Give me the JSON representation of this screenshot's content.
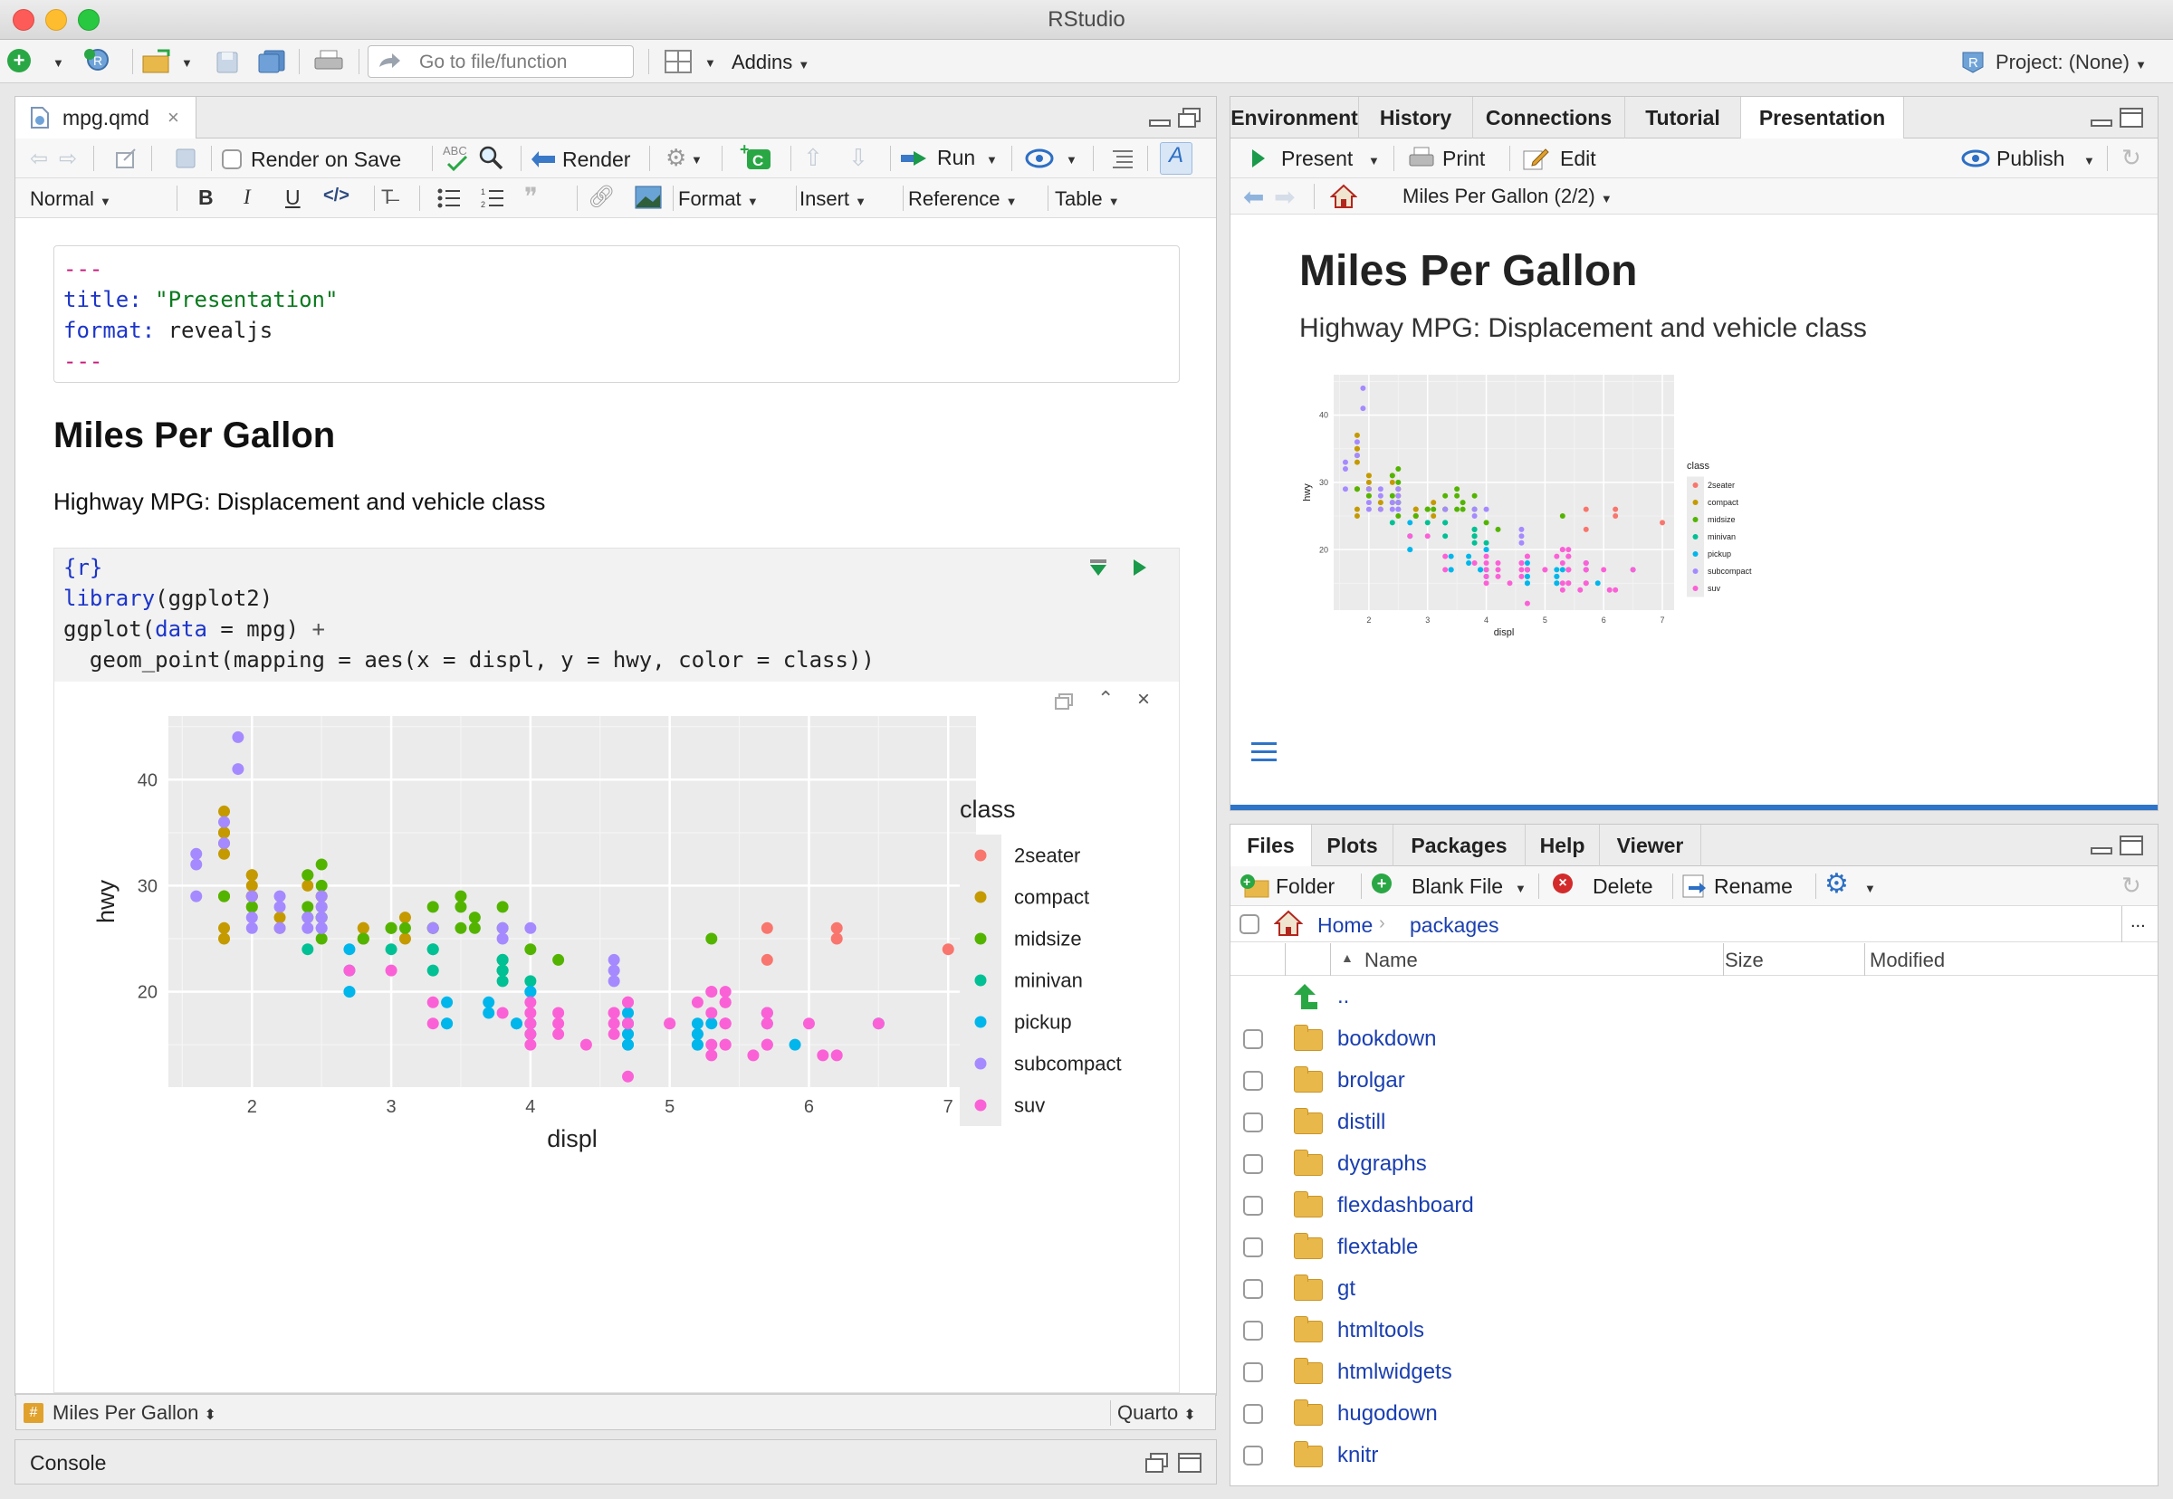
{
  "window": {
    "title": "RStudio"
  },
  "toolbar": {
    "goto_placeholder": "Go to file/function",
    "addins": "Addins",
    "project": "Project: (None)"
  },
  "editor": {
    "tab_name": "mpg.qmd",
    "render_on_save": "Render on Save",
    "render": "Render",
    "run": "Run",
    "format_style": "Normal",
    "menus": {
      "format": "Format",
      "insert": "Insert",
      "reference": "Reference",
      "table": "Table"
    },
    "yaml": {
      "dashes": "---",
      "title_key": "title:",
      "title_val": "\"Presentation\"",
      "format_key": "format:",
      "format_val": "revealjs"
    },
    "heading": "Miles Per Gallon",
    "paragraph": "Highway MPG: Displacement and vehicle class",
    "code": {
      "line1": "{r}",
      "lib_fn": "library",
      "lib_arg": "(ggplot2)",
      "line3a": "ggplot(",
      "line3b": "data",
      "line3c": " = mpg) ",
      "line3d": "+",
      "line4": "  geom_point(mapping = aes(x = displ, y = hwy, color = class))"
    },
    "status_section": "Miles Per Gallon",
    "status_mode": "Quarto"
  },
  "console": {
    "label": "Console"
  },
  "top_right": {
    "tabs": [
      "Environment",
      "History",
      "Connections",
      "Tutorial",
      "Presentation"
    ],
    "present": "Present",
    "print": "Print",
    "edit": "Edit",
    "publish": "Publish",
    "slide_nav": "Miles Per Gallon (2/2)",
    "slide_title": "Miles Per Gallon",
    "slide_subtitle": "Highway MPG: Displacement and vehicle class"
  },
  "bottom_right": {
    "tabs": [
      "Files",
      "Plots",
      "Packages",
      "Help",
      "Viewer"
    ],
    "folder": "Folder",
    "blank_file": "Blank File",
    "delete": "Delete",
    "rename": "Rename",
    "crumb_home": "Home",
    "crumb_sub": "packages",
    "more": "...",
    "col_name": "Name",
    "col_size": "Size",
    "col_modified": "Modified",
    "up": "..",
    "files": [
      "bookdown",
      "brolgar",
      "distill",
      "dygraphs",
      "flexdashboard",
      "flextable",
      "gt",
      "htmltools",
      "htmlwidgets",
      "hugodown",
      "knitr"
    ]
  },
  "chart_data": {
    "type": "scatter",
    "xlabel": "displ",
    "ylabel": "hwy",
    "xlim": [
      1.4,
      7.2
    ],
    "ylim": [
      11,
      46
    ],
    "x_ticks": [
      2,
      3,
      4,
      5,
      6,
      7
    ],
    "y_ticks": [
      20,
      30,
      40
    ],
    "grid": true,
    "legend_title": "class",
    "legend_position": "right",
    "series": [
      {
        "name": "2seater",
        "color": "#F8766D",
        "points": [
          [
            5.7,
            26
          ],
          [
            5.7,
            23
          ],
          [
            6.2,
            26
          ],
          [
            6.2,
            25
          ],
          [
            7.0,
            24
          ]
        ]
      },
      {
        "name": "compact",
        "color": "#C49A00",
        "points": [
          [
            1.8,
            29
          ],
          [
            1.8,
            29
          ],
          [
            2.0,
            31
          ],
          [
            2.0,
            30
          ],
          [
            2.8,
            26
          ],
          [
            2.8,
            26
          ],
          [
            3.1,
            27
          ],
          [
            1.8,
            26
          ],
          [
            1.8,
            25
          ],
          [
            2.0,
            28
          ],
          [
            2.0,
            29
          ],
          [
            2.8,
            25
          ],
          [
            2.8,
            25
          ],
          [
            3.1,
            25
          ],
          [
            2.2,
            27
          ],
          [
            2.2,
            26
          ],
          [
            2.4,
            31
          ],
          [
            2.4,
            30
          ],
          [
            3.0,
            26
          ],
          [
            3.3,
            26
          ],
          [
            1.8,
            34
          ],
          [
            1.8,
            37
          ],
          [
            1.8,
            35
          ],
          [
            2.5,
            29
          ],
          [
            2.5,
            29
          ],
          [
            2.5,
            28
          ],
          [
            2.0,
            29
          ],
          [
            2.0,
            29
          ],
          [
            2.8,
            25
          ],
          [
            1.8,
            33
          ],
          [
            1.8,
            35
          ],
          [
            2.0,
            29
          ],
          [
            2.0,
            31
          ]
        ]
      },
      {
        "name": "midsize",
        "color": "#53B400",
        "points": [
          [
            2.4,
            27
          ],
          [
            2.5,
            30
          ],
          [
            2.5,
            32
          ],
          [
            3.3,
            26
          ],
          [
            3.5,
            29
          ],
          [
            3.5,
            26
          ],
          [
            3.8,
            28
          ],
          [
            3.8,
            26
          ],
          [
            2.5,
            27
          ],
          [
            2.5,
            25
          ],
          [
            3.0,
            26
          ],
          [
            3.1,
            26
          ],
          [
            3.5,
            28
          ],
          [
            3.8,
            23
          ],
          [
            2.4,
            28
          ],
          [
            3.0,
            26
          ],
          [
            3.3,
            26
          ],
          [
            3.8,
            22
          ],
          [
            4.0,
            24
          ],
          [
            4.2,
            23
          ],
          [
            5.3,
            25
          ],
          [
            1.8,
            29
          ],
          [
            2.0,
            28
          ],
          [
            2.8,
            25
          ],
          [
            3.6,
            27
          ],
          [
            3.6,
            26
          ],
          [
            2.4,
            31
          ],
          [
            2.5,
            27
          ],
          [
            2.5,
            27
          ],
          [
            3.3,
            28
          ]
        ]
      },
      {
        "name": "minivan",
        "color": "#00C094",
        "points": [
          [
            2.4,
            24
          ],
          [
            3.0,
            24
          ],
          [
            3.3,
            22
          ],
          [
            3.3,
            24
          ],
          [
            3.8,
            23
          ],
          [
            3.8,
            22
          ],
          [
            4.0,
            21
          ],
          [
            3.8,
            21
          ],
          [
            3.8,
            23
          ],
          [
            3.8,
            22
          ],
          [
            3.3,
            24
          ]
        ]
      },
      {
        "name": "pickup",
        "color": "#00B6EB",
        "points": [
          [
            2.7,
            20
          ],
          [
            2.7,
            22
          ],
          [
            3.4,
            19
          ],
          [
            3.4,
            17
          ],
          [
            4.0,
            20
          ],
          [
            4.0,
            17
          ],
          [
            4.7,
            17
          ],
          [
            4.7,
            16
          ],
          [
            4.7,
            15
          ],
          [
            5.2,
            17
          ],
          [
            5.2,
            16
          ],
          [
            5.7,
            17
          ],
          [
            5.9,
            15
          ],
          [
            4.7,
            16
          ],
          [
            4.7,
            15
          ],
          [
            4.7,
            17
          ],
          [
            5.2,
            16
          ],
          [
            5.2,
            15
          ],
          [
            3.7,
            19
          ],
          [
            3.7,
            18
          ],
          [
            3.9,
            17
          ],
          [
            3.9,
            17
          ],
          [
            4.7,
            17
          ],
          [
            5.2,
            15
          ],
          [
            5.3,
            17
          ],
          [
            4.0,
            16
          ],
          [
            4.7,
            18
          ],
          [
            5.7,
            18
          ],
          [
            6.5,
            17
          ],
          [
            2.7,
            24
          ],
          [
            2.7,
            20
          ],
          [
            3.4,
            17
          ],
          [
            4.0,
            20
          ]
        ]
      },
      {
        "name": "subcompact",
        "color": "#A58AFF",
        "points": [
          [
            1.6,
            33
          ],
          [
            1.6,
            32
          ],
          [
            1.6,
            29
          ],
          [
            1.8,
            36
          ],
          [
            1.8,
            34
          ],
          [
            1.9,
            44
          ],
          [
            1.9,
            41
          ],
          [
            2.0,
            26
          ],
          [
            2.0,
            29
          ],
          [
            2.0,
            27
          ],
          [
            2.2,
            26
          ],
          [
            2.4,
            27
          ],
          [
            2.4,
            26
          ],
          [
            2.5,
            26
          ],
          [
            2.5,
            27
          ],
          [
            2.5,
            26
          ],
          [
            3.8,
            26
          ],
          [
            3.8,
            25
          ],
          [
            4.0,
            26
          ],
          [
            4.6,
            23
          ],
          [
            4.6,
            22
          ],
          [
            4.6,
            21
          ],
          [
            2.5,
            29
          ],
          [
            2.2,
            28
          ],
          [
            2.2,
            29
          ],
          [
            3.3,
            26
          ],
          [
            2.5,
            28
          ]
        ]
      },
      {
        "name": "suv",
        "color": "#FB61D7",
        "points": [
          [
            5.3,
            20
          ],
          [
            5.3,
            15
          ],
          [
            5.3,
            14
          ],
          [
            5.7,
            15
          ],
          [
            6.0,
            17
          ],
          [
            5.7,
            17
          ],
          [
            5.7,
            18
          ],
          [
            6.2,
            14
          ],
          [
            6.5,
            17
          ],
          [
            4.0,
            17
          ],
          [
            4.0,
            15
          ],
          [
            4.6,
            17
          ],
          [
            5.4,
            17
          ],
          [
            5.4,
            17
          ],
          [
            4.2,
            17
          ],
          [
            4.2,
            18
          ],
          [
            4.6,
            18
          ],
          [
            4.7,
            17
          ],
          [
            5.2,
            19
          ],
          [
            5.4,
            20
          ],
          [
            5.4,
            17
          ],
          [
            5.7,
            18
          ],
          [
            3.3,
            17
          ],
          [
            3.8,
            18
          ],
          [
            4.0,
            18
          ],
          [
            4.7,
            12
          ],
          [
            4.7,
            19
          ],
          [
            4.2,
            16
          ],
          [
            4.4,
            15
          ],
          [
            4.6,
            16
          ],
          [
            4.7,
            17
          ],
          [
            5.4,
            15
          ],
          [
            5.7,
            15
          ],
          [
            6.1,
            14
          ],
          [
            4.0,
            19
          ],
          [
            4.6,
            18
          ],
          [
            5.0,
            17
          ],
          [
            5.4,
            15
          ],
          [
            5.6,
            14
          ],
          [
            2.7,
            22
          ],
          [
            3.0,
            22
          ],
          [
            3.3,
            19
          ],
          [
            4.0,
            16
          ],
          [
            4.7,
            19
          ],
          [
            5.0,
            17
          ],
          [
            5.3,
            18
          ],
          [
            5.4,
            19
          ],
          [
            5.7,
            17
          ],
          [
            5.3,
            20
          ],
          [
            5.4,
            19
          ]
        ]
      }
    ]
  },
  "colors": {
    "accent": "#1a3fb0",
    "render_blue": "#3a78c8",
    "run_green": "#1a9a4a",
    "presentation_bar": "#2e74c8"
  }
}
